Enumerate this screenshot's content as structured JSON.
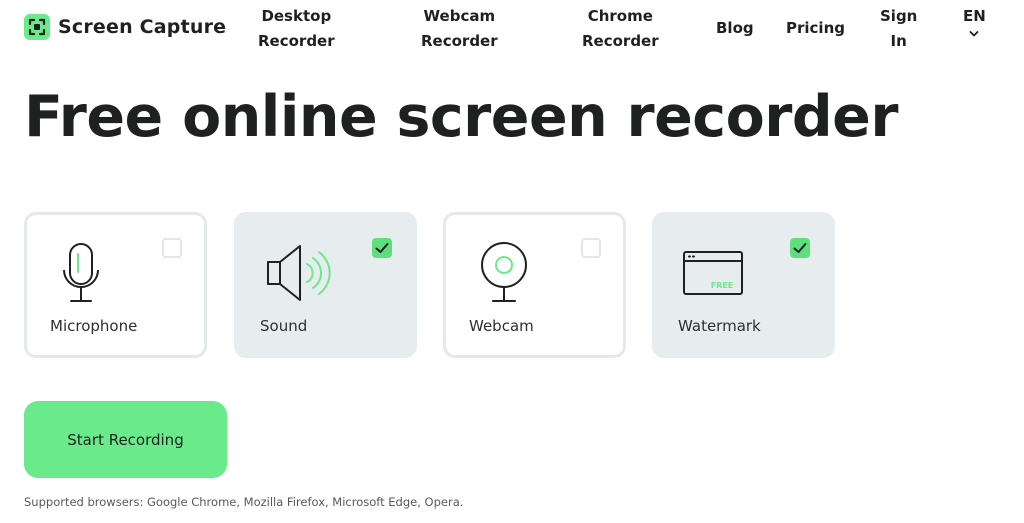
{
  "brand": {
    "name": "Screen Capture",
    "accent_color": "#6aea8a"
  },
  "nav": {
    "desktop": [
      "Desktop",
      "Recorder"
    ],
    "webcam": [
      "Webcam",
      "Recorder"
    ],
    "chrome": [
      "Chrome",
      "Recorder"
    ],
    "blog": "Blog",
    "pricing": "Pricing",
    "sign_in": [
      "Sign",
      "In"
    ],
    "language": "EN"
  },
  "hero": {
    "title": "Free online screen recorder"
  },
  "options": [
    {
      "label": "Microphone",
      "icon": "microphone-icon",
      "checked": false
    },
    {
      "label": "Sound",
      "icon": "speaker-icon",
      "checked": true
    },
    {
      "label": "Webcam",
      "icon": "webcam-icon",
      "checked": false
    },
    {
      "label": "Watermark",
      "icon": "watermark-icon",
      "checked": true,
      "badge": "FREE"
    }
  ],
  "cta": {
    "start_label": "Start Recording"
  },
  "footer": {
    "supported": "Supported browsers: Google Chrome, Mozilla Firefox, Microsoft Edge, Opera."
  }
}
